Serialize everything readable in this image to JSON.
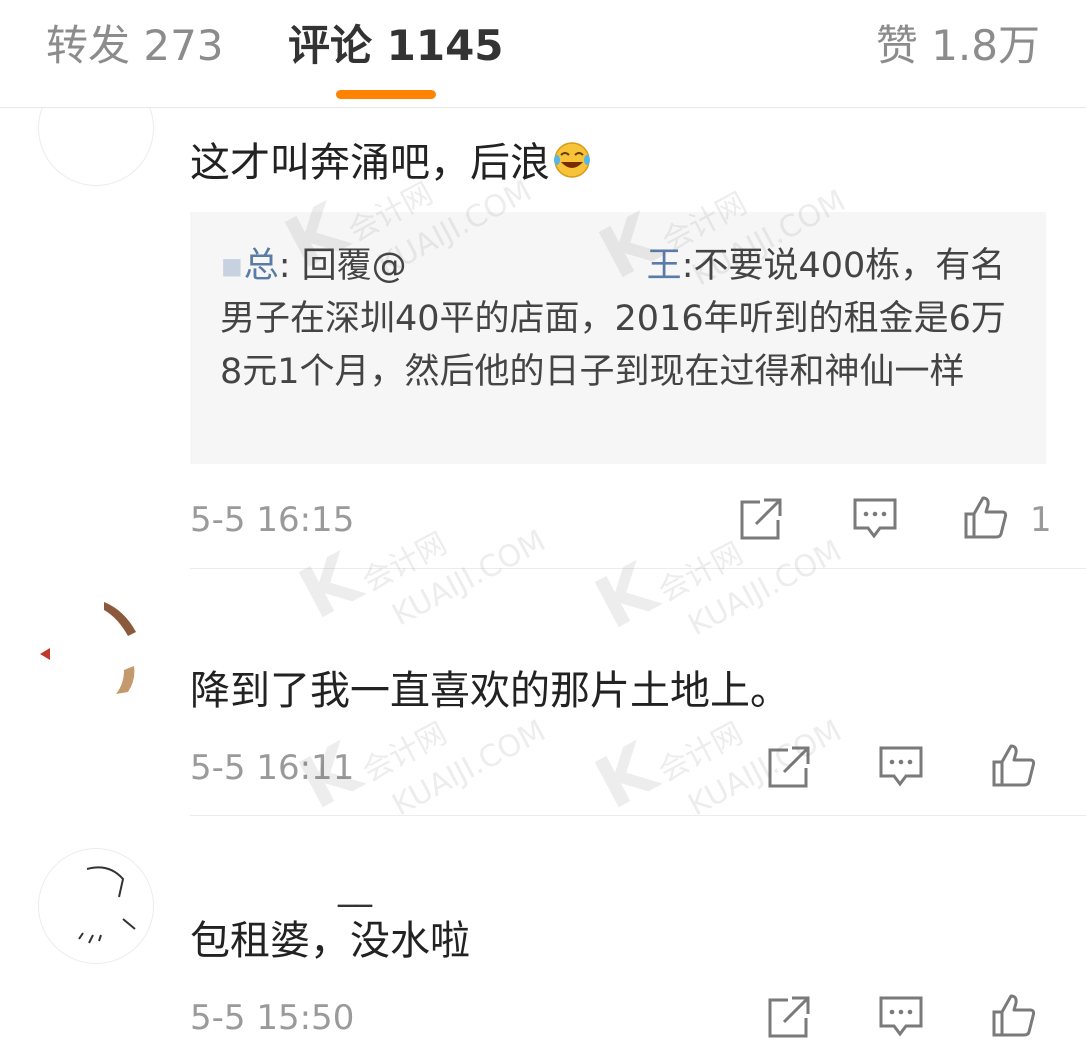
{
  "tabs": {
    "repost": "转发 273",
    "comment": "评论 1145",
    "like": "赞 1.8万"
  },
  "colors": {
    "accent": "#ff8200",
    "link": "#5a7ba7"
  },
  "watermark": {
    "cn": "会计网",
    "en": "KUAIJI.COM"
  },
  "comments": [
    {
      "text": "这才叫奔涌吧，后浪",
      "emoji": "laughing-tears-emoji",
      "quote": {
        "name_suffix": "总",
        "reply_prefix": ": 回覆@",
        "target_suffix": "王",
        "body_line1": ":不要说400栋，有",
        "body_rest": "名男子在深圳40平的店面，2016年听到的租金是6万8元1个月，然后他的日子到现在过得和神仙一样"
      },
      "time": "5-5 16:15",
      "likes": "1",
      "icons": [
        "share-icon",
        "comment-icon",
        "like-icon"
      ]
    },
    {
      "text": "降到了我一直喜欢的那片土地上。",
      "time": "5-5 16:11",
      "likes": "",
      "icons": [
        "share-icon",
        "comment-icon",
        "like-icon"
      ]
    },
    {
      "username": "__",
      "text": "包租婆，没水啦",
      "time": "5-5 15:50",
      "likes": "",
      "icons": [
        "share-icon",
        "comment-icon",
        "like-icon"
      ]
    }
  ]
}
